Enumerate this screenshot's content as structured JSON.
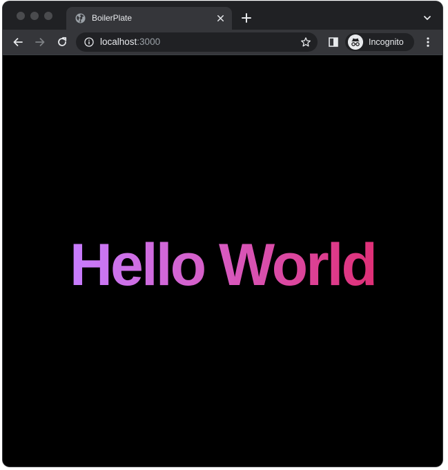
{
  "browser": {
    "tab": {
      "title": "BoilerPlate",
      "favicon": "globe-icon"
    },
    "address_bar": {
      "host": "localhost",
      "port": ":3000"
    },
    "profile": {
      "label": "Incognito",
      "icon": "incognito-icon"
    }
  },
  "page": {
    "heading": "Hello World",
    "gradient_colors": [
      "#c77dff",
      "#d75ac0",
      "#df2f76"
    ],
    "background": "#000000"
  },
  "colors": {
    "tabstrip_bg": "#202124",
    "toolbar_bg": "#35363a",
    "omnibox_bg": "#202124",
    "text_primary": "#e8eaed",
    "text_muted": "#9aa0a6"
  }
}
